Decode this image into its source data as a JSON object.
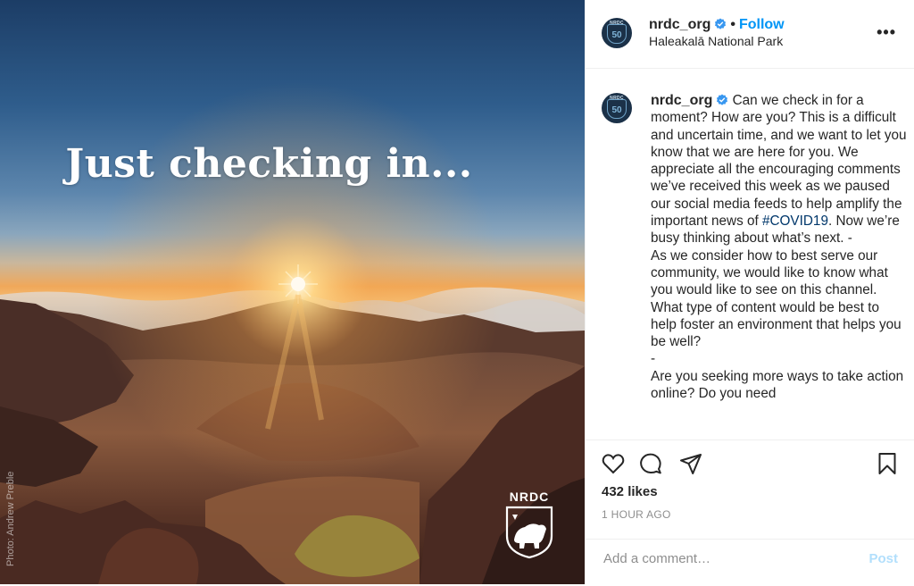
{
  "image": {
    "headline": "Just checking in...",
    "credit": "Photo: Andrew Preble",
    "logo_text": "NRDC"
  },
  "header": {
    "avatar_label": "NRDC",
    "avatar_number": "50",
    "username": "nrdc_org",
    "separator": "•",
    "follow_label": "Follow",
    "location": "Haleakalā National Park",
    "more_label": "•••"
  },
  "caption": {
    "username": "nrdc_org",
    "text_before_tag": "Can we check in for a moment? How are you? This is a difficult and uncertain time, and we want to let you know that we are here for you. We appreciate all the encouraging comments we’ve received this week as we paused our social media feeds to help amplify the important news of ",
    "hashtag": "#COVID19",
    "text_after_tag": ". Now we’re busy thinking about what’s next. -",
    "paragraph_2": "As we consider how to best serve our community, we would like to know what you would like to see on this channel. What type of content would be best to help foster an environment that helps you be well?",
    "separator_line": "-",
    "paragraph_3": "Are you seeking more ways to take action online? Do you need"
  },
  "actions": {
    "icons": [
      "heart-icon",
      "comment-icon",
      "share-icon",
      "bookmark-icon"
    ],
    "likes": "432 likes",
    "time_ago": "1 HOUR AGO"
  },
  "comment": {
    "placeholder": "Add a comment…",
    "post_label": "Post"
  },
  "colors": {
    "accent": "#0095f6",
    "post_disabled": "#b2dffc",
    "hashtag": "#00376b",
    "muted": "#8e8e8e"
  }
}
